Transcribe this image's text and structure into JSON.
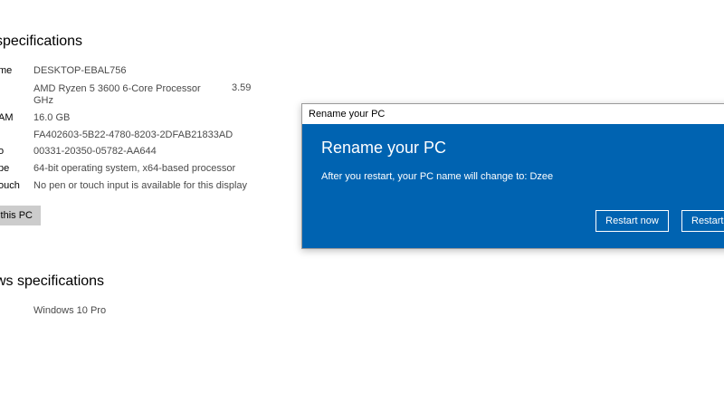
{
  "device": {
    "title": "specifications",
    "rows": [
      {
        "label": "me",
        "value": "DESKTOP-EBAL756"
      },
      {
        "label": "",
        "value": "AMD Ryzen 5 3600 6-Core Processor",
        "value2": "GHz",
        "extra": "3.59"
      },
      {
        "label": "AM",
        "value": "16.0 GB"
      },
      {
        "label": "",
        "value": "FA402603-5B22-4780-8203-2DFAB21833AD"
      },
      {
        "label": "",
        "value": "00331-20350-05782-AA644"
      },
      {
        "label": "pe",
        "value": "64-bit operating system, x64-based processor"
      },
      {
        "label": "ouch",
        "value": "No pen or touch input is available for this display"
      }
    ],
    "rename_button": "this PC"
  },
  "windows": {
    "title": "ws specifications",
    "edition": "Windows 10 Pro"
  },
  "dialog": {
    "window_title": "Rename your PC",
    "heading": "Rename your PC",
    "message": "After you restart, your PC name will change to: Dzee",
    "restart_now": "Restart now",
    "restart_later": "Restart"
  }
}
